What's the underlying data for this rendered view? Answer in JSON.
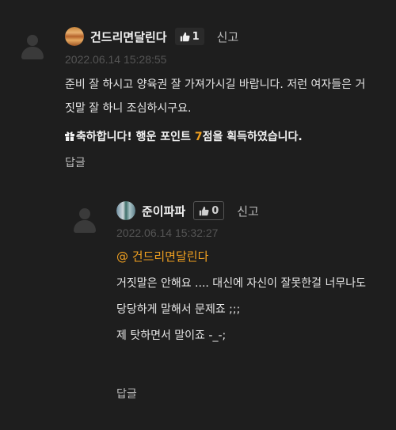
{
  "comment1": {
    "nickname": "건드리면달린다",
    "likes": "1",
    "report_label": "신고",
    "date": "2022.06.14 15:28:55",
    "text_line1": "준비 잘 하시고 양육권 잘 가져가시길 바랍니다. 저런 여자들은 거",
    "text_line2": "짓말 잘 하니 조심하시구요.",
    "notice_pre": "축하합니다! 행운 포인트 ",
    "notice_num": "7",
    "notice_post": "점을 획득하였습니다.",
    "reply_label": "답글"
  },
  "comment2": {
    "nickname": "준이파파",
    "likes": "0",
    "report_label": "신고",
    "date": "2022.06.14 15:32:27",
    "mention": "@ 건드리면달린다",
    "lines": [
      "거짓말은 안해요  .... 대신에 자신이 잘못한걸 너무나도",
      "당당하게 말해서 문제죠 ;;;",
      "제 탓하면서 말이죠 -_-;"
    ],
    "reply_label": "답글"
  },
  "colors": {
    "background": "#1e1e1e",
    "accent": "#f0a020",
    "date": "#555555"
  },
  "icons": {
    "avatar": "user-silhouette-icon",
    "like": "thumbs-up-icon",
    "gift": "gift-icon"
  }
}
